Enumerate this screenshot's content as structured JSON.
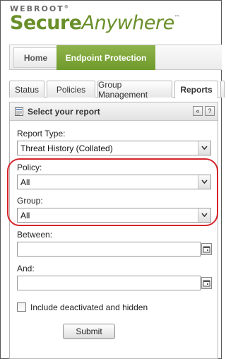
{
  "brand": {
    "top": "WEBROOT",
    "top_mark": "®",
    "main_bold": "Secure",
    "main_italic": "Anywhere",
    "main_mark": "™"
  },
  "topnav": {
    "home": "Home",
    "endpoint": "Endpoint Protection",
    "active_color": "#7ea53a"
  },
  "subtabs": [
    {
      "label": "Status"
    },
    {
      "label": "Policies"
    },
    {
      "label": "Group Management"
    },
    {
      "label": "Reports",
      "active": true
    }
  ],
  "panel": {
    "title": "Select your report",
    "collapse_label": "«",
    "help_label": "?"
  },
  "form": {
    "report_type_label": "Report Type:",
    "report_type_value": "Threat History (Collated)",
    "policy_label": "Policy:",
    "policy_value": "All",
    "group_label": "Group:",
    "group_value": "All",
    "between_label": "Between:",
    "between_value": "",
    "and_label": "And:",
    "and_value": "",
    "include_label": "Include deactivated and hidden",
    "include_checked": false,
    "submit_label": "Submit"
  },
  "highlight_color": "#d6232a"
}
